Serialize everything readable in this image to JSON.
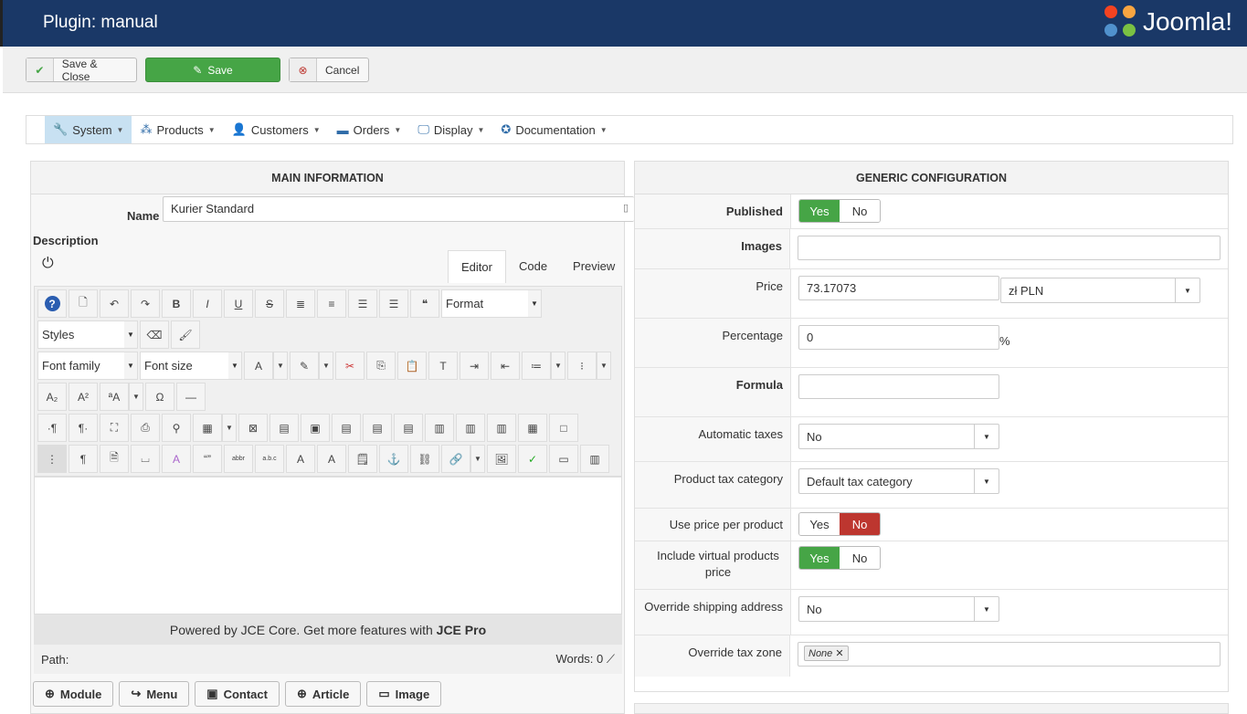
{
  "header": {
    "title": "Plugin: manual",
    "logo_text": "Joomla!"
  },
  "toolbar": {
    "save_close": "Save & Close",
    "save": "Save",
    "cancel": "Cancel"
  },
  "nav": [
    {
      "label": "System",
      "icon": "wrench-icon",
      "glyph": "🔧"
    },
    {
      "label": "Products",
      "icon": "cubes-icon",
      "glyph": "⁂"
    },
    {
      "label": "Customers",
      "icon": "user-icon",
      "glyph": "👤"
    },
    {
      "label": "Orders",
      "icon": "credit-card-icon",
      "glyph": "▬"
    },
    {
      "label": "Display",
      "icon": "monitor-icon",
      "glyph": "🖵"
    },
    {
      "label": "Documentation",
      "icon": "lifebuoy-icon",
      "glyph": "✪"
    }
  ],
  "main": {
    "title": "MAIN INFORMATION",
    "name_label": "Name",
    "name_value": "Kurier Standard",
    "description_label": "Description",
    "tabs": [
      "Editor",
      "Code",
      "Preview"
    ],
    "editor": {
      "format": "Format",
      "styles": "Styles",
      "font_family": "Font family",
      "font_size": "Font size",
      "powered_prefix": "Powered by JCE Core. Get more features with ",
      "powered_pro": "JCE Pro",
      "path": "Path:",
      "words": "Words: 0"
    },
    "buttons": [
      "Module",
      "Menu",
      "Contact",
      "Article",
      "Image"
    ]
  },
  "config": {
    "title": "GENERIC CONFIGURATION",
    "published": {
      "label": "Published",
      "yes": "Yes",
      "no": "No"
    },
    "images": {
      "label": "Images",
      "value": ""
    },
    "price": {
      "label": "Price",
      "value": "73.17073",
      "currency": "zł PLN"
    },
    "percentage": {
      "label": "Percentage",
      "value": "0",
      "suffix": "%"
    },
    "formula": {
      "label": "Formula",
      "value": ""
    },
    "auto_taxes": {
      "label": "Automatic taxes",
      "value": "No"
    },
    "tax_category": {
      "label": "Product tax category",
      "value": "Default tax category"
    },
    "price_per_product": {
      "label": "Use price per product",
      "yes": "Yes",
      "no": "No"
    },
    "include_virtual": {
      "label": "Include virtual products price",
      "yes": "Yes",
      "no": "No"
    },
    "override_shipping": {
      "label": "Override shipping address",
      "value": "No"
    },
    "override_tax_zone": {
      "label": "Override tax zone",
      "tag": "None"
    }
  },
  "editor_toolbar": [
    [
      "help-icon",
      "?"
    ],
    [
      "new-document-icon",
      "🗋"
    ],
    [
      "undo-icon",
      "↶"
    ],
    [
      "redo-icon",
      "↷"
    ],
    [
      "bold-icon",
      "B"
    ],
    [
      "italic-icon",
      "I"
    ],
    [
      "underline-icon",
      "U"
    ],
    [
      "strikethrough-icon",
      "S"
    ],
    [
      "justify-icon",
      "≣"
    ],
    [
      "align-center-icon",
      "≡"
    ],
    [
      "align-left-icon",
      "☰"
    ],
    [
      "align-right-icon",
      "☰"
    ],
    [
      "blockquote-icon",
      "❝"
    ],
    [
      "FORMAT"
    ],
    [
      "BR"
    ],
    [
      "STYLES"
    ],
    [
      "eraser-icon",
      "⌫"
    ],
    [
      "cleanup-brush-icon",
      "🖌"
    ],
    [
      "BR"
    ],
    [
      "FONTFAMILY"
    ],
    [
      "FONTSIZE"
    ],
    [
      "text-color-icon",
      "A"
    ],
    [
      "DD"
    ],
    [
      "highlight-icon",
      "✎"
    ],
    [
      "DD"
    ],
    [
      "cut-icon",
      "✂"
    ],
    [
      "copy-icon",
      "⎘"
    ],
    [
      "paste-icon",
      "📋"
    ],
    [
      "paste-text-icon",
      "T"
    ],
    [
      "indent-icon",
      "⇥"
    ],
    [
      "outdent-icon",
      "⇤"
    ],
    [
      "numbered-list-icon",
      "≔"
    ],
    [
      "DD"
    ],
    [
      "bullet-list-icon",
      "⁝"
    ],
    [
      "DD"
    ],
    [
      "BR"
    ],
    [
      "subscript-icon",
      "A₂"
    ],
    [
      "superscript-icon",
      "A²"
    ],
    [
      "charmap-case-icon",
      "ªA"
    ],
    [
      "DD"
    ],
    [
      "omega-icon",
      "Ω"
    ],
    [
      "horizontal-rule-icon",
      "—"
    ],
    [
      "BR"
    ],
    [
      "ltr-icon",
      "·¶"
    ],
    [
      "rtl-icon",
      "¶·"
    ],
    [
      "fullscreen-icon",
      "⛶"
    ],
    [
      "print-icon",
      "⎙"
    ],
    [
      "search-replace-icon",
      "⚲"
    ],
    [
      "table-icon",
      "▦"
    ],
    [
      "DD"
    ],
    [
      "delete-table-icon",
      "⊠"
    ],
    [
      "row-props-icon",
      "▤"
    ],
    [
      "cell-props-icon",
      "▣"
    ],
    [
      "insert-row-before-icon",
      "▤"
    ],
    [
      "insert-row-after-icon",
      "▤"
    ],
    [
      "delete-row-icon",
      "▤"
    ],
    [
      "insert-col-before-icon",
      "▥"
    ],
    [
      "insert-col-after-icon",
      "▥"
    ],
    [
      "delete-col-icon",
      "▥"
    ],
    [
      "split-cells-icon",
      "▦"
    ],
    [
      "merge-cells-icon",
      "□"
    ],
    [
      "BR"
    ],
    [
      "visual-aid-icon",
      "⋮"
    ],
    [
      "paragraph-icon",
      "¶"
    ],
    [
      "preview-icon",
      "🗎"
    ],
    [
      "pagebreak-icon",
      "⌴"
    ],
    [
      "style-icon",
      "A"
    ],
    [
      "cite-icon",
      "“”"
    ],
    [
      "abbr-icon",
      "abbr"
    ],
    [
      "acronym-icon",
      "a.b.c"
    ],
    [
      "delete-text-icon",
      "A"
    ],
    [
      "insert-text-icon",
      "A"
    ],
    [
      "attributes-icon",
      "🗒"
    ],
    [
      "anchor-icon",
      "⚓"
    ],
    [
      "unlink-icon",
      "⛓"
    ],
    [
      "link-icon",
      "🔗"
    ],
    [
      "DD"
    ],
    [
      "image-icon",
      "🖼"
    ],
    [
      "spellcheck-icon",
      "✓"
    ],
    [
      "template-icon",
      "▭"
    ],
    [
      "article-icon",
      "▥"
    ]
  ]
}
